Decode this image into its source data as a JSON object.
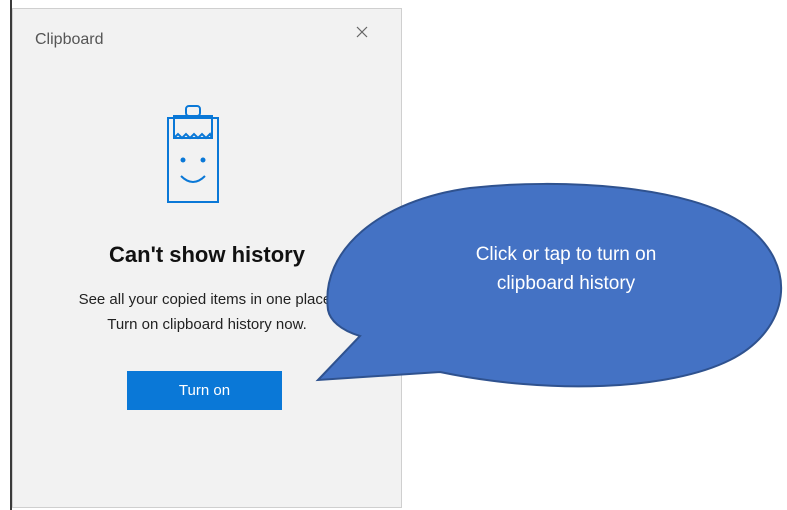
{
  "panel": {
    "title": "Clipboard",
    "close_icon": "close-icon",
    "clipboard_icon": "clipboard-face-icon",
    "heading": "Can't show history",
    "desc_line1": "See all your copied items in one place.",
    "desc_line2": "Turn on clipboard history now.",
    "button_label": "Turn on"
  },
  "callout": {
    "text": "Click or tap to turn on clipboard history",
    "line1": "Click or tap to turn on",
    "line2": "clipboard history",
    "fill": "#4472c4",
    "stroke": "#2f528f"
  },
  "colors": {
    "panel_bg": "#f2f2f2",
    "accent": "#0a78d7"
  }
}
